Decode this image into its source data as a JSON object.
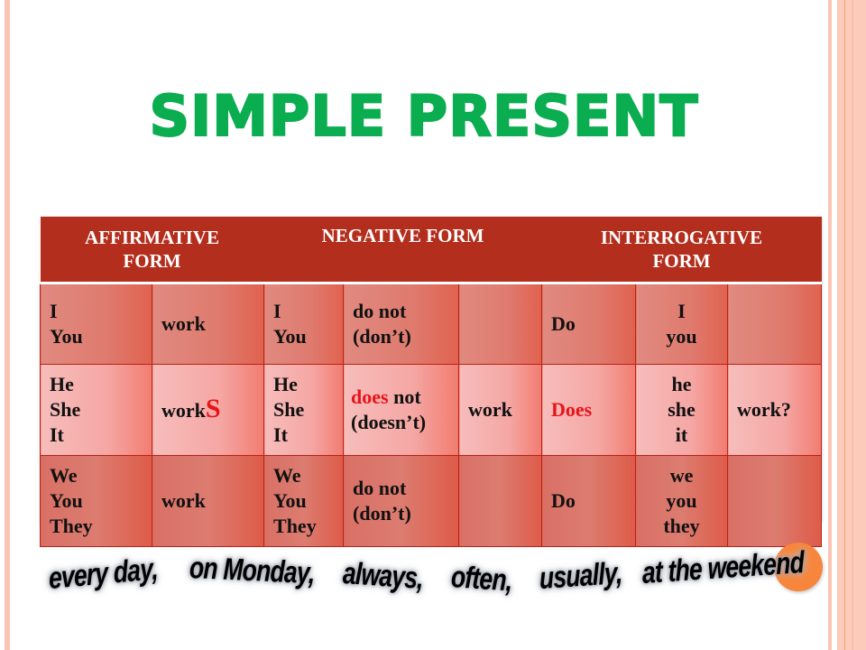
{
  "title": "SIMPLE PRESENT",
  "colors": {
    "title_green": "#0aad4f",
    "header_red": "#b32e1d",
    "highlight_red": "#e8141a",
    "accent_orange": "#f7853b",
    "border_pink": "#fcc5b3"
  },
  "table": {
    "headers": [
      {
        "label": "AFFIRMATIVE FORM",
        "line1": "AFFIRMATIVE",
        "line2": "FORM"
      },
      {
        "label": "NEGATIVE FORM"
      },
      {
        "label": "INTERROGATIVE FORM",
        "line1": "INTERROGATIVE",
        "line2": "FORM"
      }
    ],
    "rows": [
      {
        "aff_pronouns": [
          "I",
          "You"
        ],
        "aff_verb": "work",
        "neg_pronouns": [
          "I",
          "You"
        ],
        "neg_aux": [
          "do not",
          "(don’t)"
        ],
        "neg_verb": "",
        "int_aux": "Do",
        "int_pronouns": [
          "I",
          "you"
        ],
        "int_verb": ""
      },
      {
        "aff_pronouns": [
          "He",
          "She",
          "It"
        ],
        "aff_verb": "work",
        "aff_verb_suffix": "S",
        "neg_pronouns": [
          "He",
          "She",
          "It"
        ],
        "neg_aux_highlight": "does",
        "neg_aux_rest": " not",
        "neg_aux_contraction": "(doesn’t)",
        "neg_verb": "work",
        "int_aux": "Does",
        "int_pronouns": [
          "he",
          "she",
          "it"
        ],
        "int_verb": "work?"
      },
      {
        "aff_pronouns": [
          "We",
          "You",
          "They"
        ],
        "aff_verb": "work",
        "neg_pronouns": [
          "We",
          "You",
          "They"
        ],
        "neg_aux": [
          "do not",
          "(don’t)"
        ],
        "neg_verb": "",
        "int_aux": "Do",
        "int_pronouns": [
          "we",
          "you",
          "they"
        ],
        "int_verb": ""
      }
    ]
  },
  "adverbs": [
    "every day,",
    "on Monday,",
    "always,",
    "often,",
    "usually,",
    "at the weekend"
  ]
}
